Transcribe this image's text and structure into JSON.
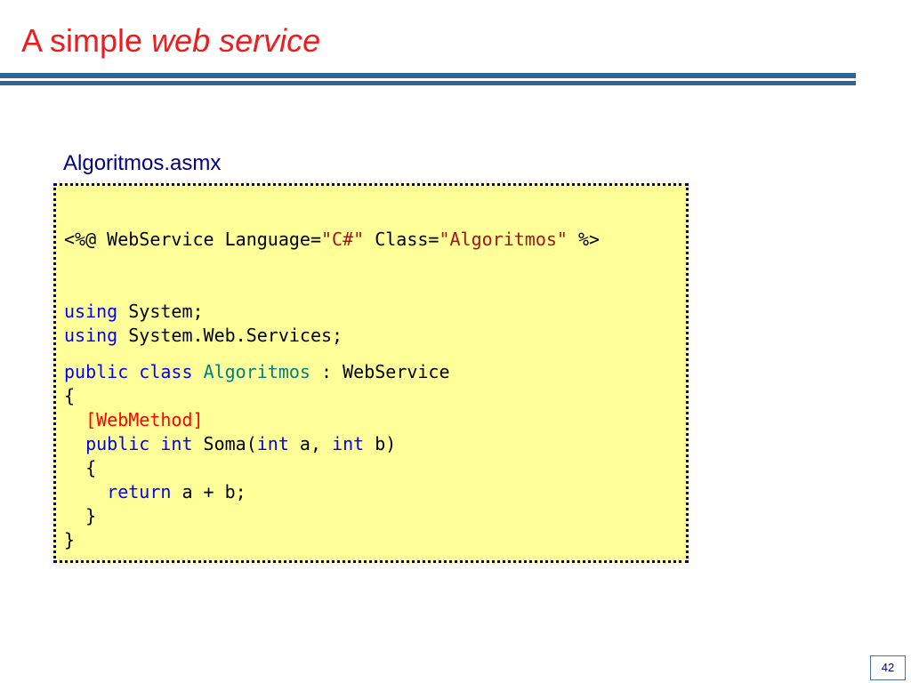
{
  "slide": {
    "title_plain": "A simple ",
    "title_emphasis": "web service",
    "file_name": "Algoritmos.asmx",
    "page_number": "42"
  },
  "code": {
    "l1_a": "<%@ WebService Language=",
    "l1_b": "\"C#\"",
    "l1_c": " Class=",
    "l1_d": "\"Algoritmos\"",
    "l1_e": " %>",
    "l2_a": "using",
    "l2_b": " System;",
    "l3_a": "using",
    "l3_b": " System.Web.Services;",
    "l4_a": "public",
    "l4_b": " ",
    "l4_c": "class",
    "l4_d": " ",
    "l4_e": "Algoritmos",
    "l4_f": " : WebService",
    "l5": "{",
    "l6_indent": "  ",
    "l6": "[WebMethod]",
    "l7_indent": "  ",
    "l7_a": "public",
    "l7_b": " ",
    "l7_c": "int",
    "l7_d": " Soma(",
    "l7_e": "int",
    "l7_f": " a, ",
    "l7_g": "int",
    "l7_h": " b)",
    "l8": "  {",
    "l9_indent": "    ",
    "l9_a": "return",
    "l9_b": " a + b;",
    "l10": "  }",
    "l11": "}"
  },
  "colors": {
    "title": "#ee1c1c",
    "rule": "#2e6496",
    "label": "#000080",
    "code_background": "#ffff99",
    "keyword": "#0000ff",
    "string": "#a31515",
    "type": "#008080",
    "attribute": "#ff0000"
  }
}
